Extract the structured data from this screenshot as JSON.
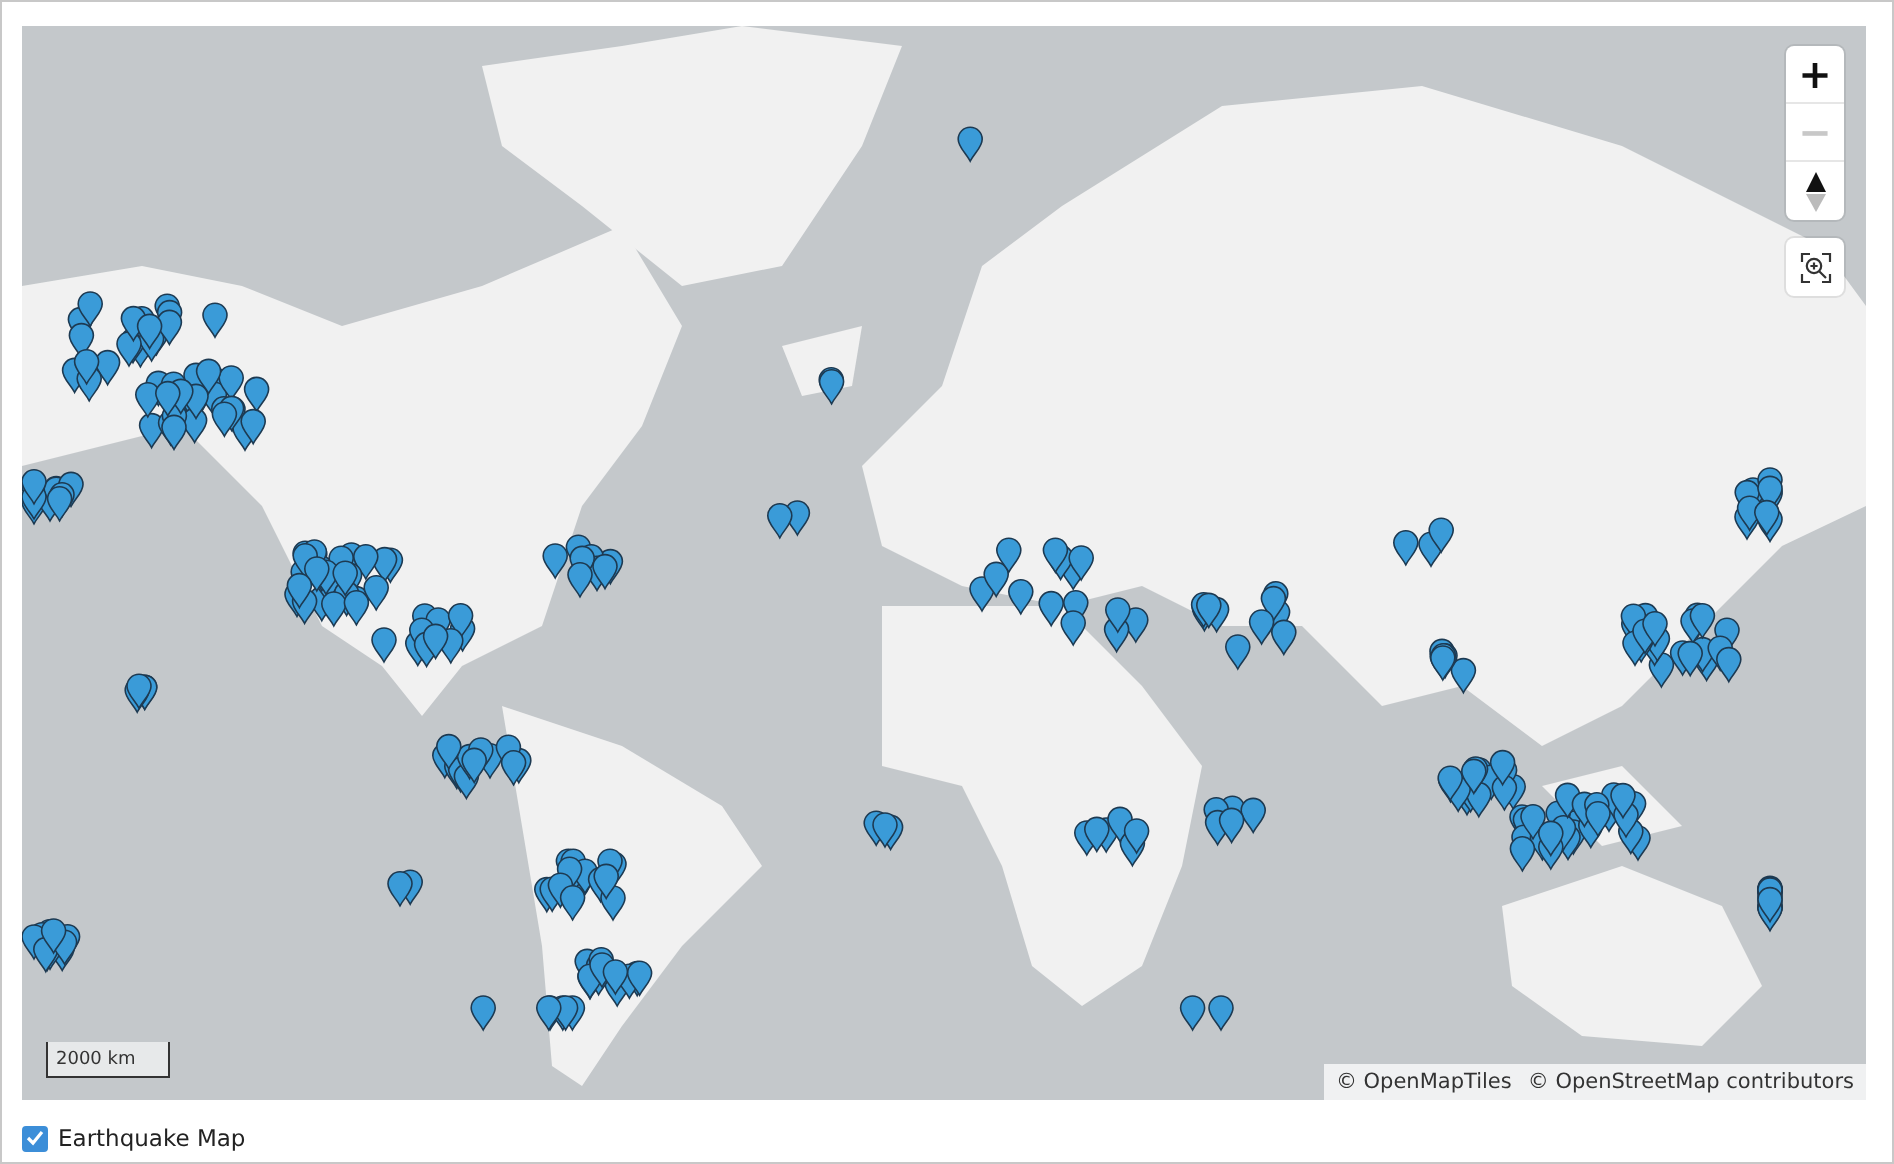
{
  "map": {
    "kind": "picture",
    "zoom_controls": [
      {
        "label": "+",
        "disabled": false
      },
      {
        "label": "−",
        "disabled": true
      }
    ],
    "scale": "2000 km",
    "attributions": [
      "© OpenMapTiles",
      "© OpenStreetMap contributors"
    ]
  },
  "layer_toggle": {
    "label": "Earthquake Map",
    "checked": true
  }
}
